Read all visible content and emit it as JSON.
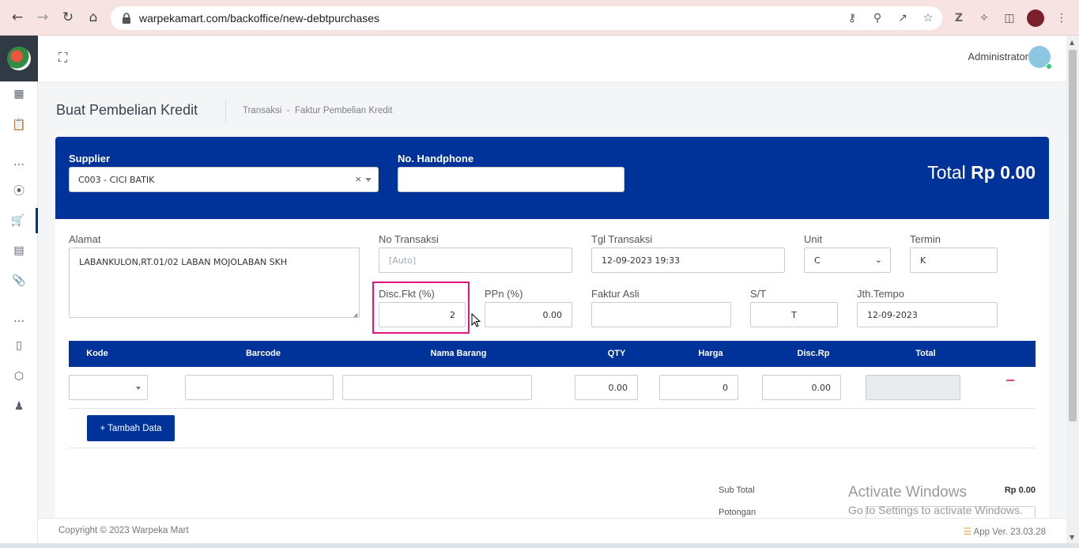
{
  "browser": {
    "url_domain": "warpekamart.com",
    "url_path": "/backoffice/new-debtpurchases"
  },
  "topbar": {
    "user_name": "Administrator"
  },
  "page": {
    "title": "Buat Pembelian Kredit",
    "breadcrumb": "Transaksi  -  Faktur Pembelian Kredit"
  },
  "header": {
    "supplier_label": "Supplier",
    "supplier_value": "C003 - CICI BATIK",
    "phone_label": "No. Handphone",
    "phone_value": "",
    "total_prefix": "Total ",
    "total_value": "Rp 0.00"
  },
  "form": {
    "alamat_label": "Alamat",
    "alamat_value": "LABANKULON,RT.01/02 LABAN MOJOLABAN SKH",
    "no_transaksi_label": "No Transaksi",
    "no_transaksi_placeholder": "[Auto]",
    "tgl_label": "Tgl Transaksi",
    "tgl_value": "12-09-2023 19:33",
    "unit_label": "Unit",
    "unit_value": "C",
    "termin_label": "Termin",
    "termin_value": "K",
    "disc_label": "Disc.Fkt (%)",
    "disc_value": "2",
    "ppn_label": "PPn (%)",
    "ppn_value": "0.00",
    "faktur_label": "Faktur Asli",
    "faktur_value": "",
    "st_label": "S/T",
    "st_value": "T",
    "jth_label": "Jth.Tempo",
    "jth_value": "12-09-2023"
  },
  "table": {
    "headers": [
      "Kode",
      "Barcode",
      "Nama Barang",
      "QTY",
      "Harga",
      "Disc.Rp",
      "Total"
    ],
    "row": {
      "qty": "0.00",
      "harga": "0",
      "disc": "0.00",
      "total": ""
    },
    "add_button": "+ Tambah Data"
  },
  "summary": {
    "subtotal_label": "Sub Total",
    "subtotal_value": "Rp 0.00",
    "potongan_label": "Potongan"
  },
  "watermark": {
    "line1": "Activate Windows",
    "line2": "Go to Settings to activate Windows."
  },
  "footer": {
    "copyright": "Copyright © 2023 Warpeka Mart",
    "version": "App Ver. 23.03.28"
  },
  "colors": {
    "primary": "#003399",
    "highlight": "#e3177a",
    "chrome": "#f7e3e2"
  }
}
